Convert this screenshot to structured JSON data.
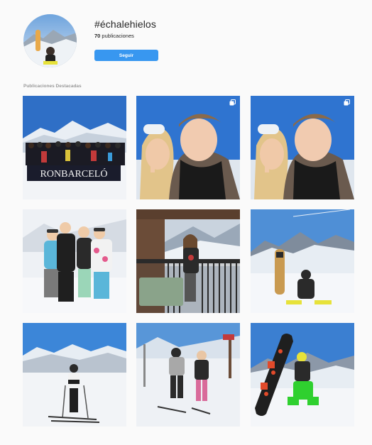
{
  "profile": {
    "hashtag": "#échalehielos",
    "count_number": "70",
    "count_label": " publicaciones",
    "follow_label": "Seguir"
  },
  "section": {
    "title": "Publicaciones Destacadas"
  },
  "posts": [
    {
      "scene": "group-banner",
      "multi": false,
      "banner_text": "RONBARCELÓ"
    },
    {
      "scene": "selfie-couple",
      "multi": true
    },
    {
      "scene": "selfie-couple",
      "multi": true
    },
    {
      "scene": "friends-group",
      "multi": false
    },
    {
      "scene": "balcony",
      "multi": false
    },
    {
      "scene": "snowboard-sitting",
      "multi": false
    },
    {
      "scene": "skier-slope",
      "multi": false
    },
    {
      "scene": "two-skiers",
      "multi": false
    },
    {
      "scene": "snowboard-kneeling",
      "multi": false
    }
  ],
  "icons": {
    "multi_post": "carousel-icon"
  },
  "colors": {
    "accent": "#3897f0",
    "background": "#fafafa"
  }
}
